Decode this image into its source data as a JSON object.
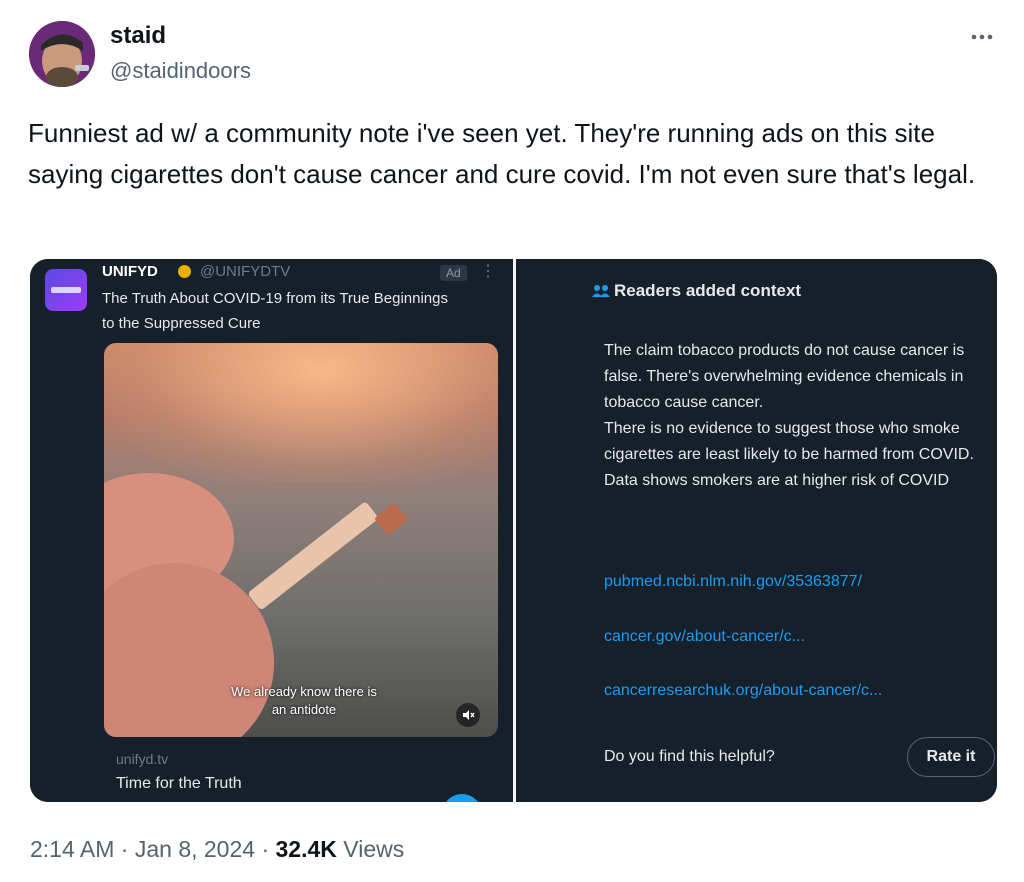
{
  "author": {
    "display_name": "staid",
    "handle": "@staidindoors"
  },
  "tweet": {
    "text": "Funniest ad w/ a community note i've seen yet. They're running ads on this site saying cigarettes don't cause cancer and cure covid. I'm not even sure that's legal."
  },
  "ad": {
    "name": "UNIFYD",
    "handle": "@UNIFYDTV",
    "badge": "Ad",
    "headline": "The Truth About COVID-19 from its True Beginnings to the Suppressed Cure",
    "video_caption": "We already know there is an antidote",
    "domain": "unifyd.tv",
    "card_title": "Time for the Truth"
  },
  "note": {
    "header": "Readers added context",
    "body": "The claim tobacco products do not cause cancer is false. There's overwhelming evidence chemicals in tobacco cause cancer.\nThere is no evidence to suggest those who smoke cigarettes are least likely to be harmed from COVID. Data shows smokers are at higher risk of COVID",
    "links": [
      "pubmed.ncbi.nlm.nih.gov/35363877/",
      "cancer.gov/about-cancer/c...",
      "cancerresearchuk.org/about-cancer/c..."
    ],
    "helpful_question": "Do you find this helpful?",
    "rate_label": "Rate it"
  },
  "footer": {
    "time": "2:14 AM",
    "date": "Jan 8, 2024",
    "views_count": "32.4K",
    "views_label": "Views"
  },
  "colors": {
    "link_blue": "#1d9bf0",
    "dark_bg": "#15202b",
    "muted": "#536471"
  }
}
